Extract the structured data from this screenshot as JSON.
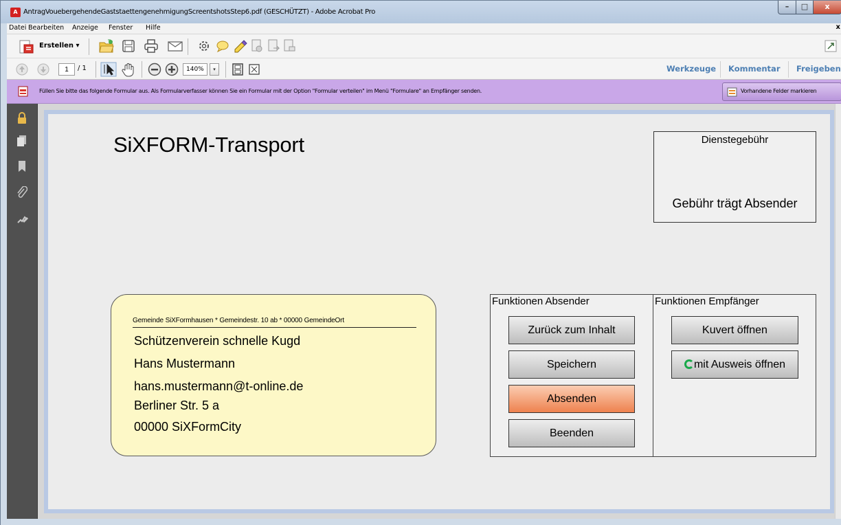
{
  "window": {
    "title": "AntragVouebergehendeGaststaettengenehmigungScreentshotsStep6.pdf (GESCHÜTZT) - Adobe Acrobat Pro",
    "controls": {
      "minimize": "–",
      "maximize": "□",
      "close": "x"
    }
  },
  "menu": {
    "items": [
      "Datei",
      "Bearbeiten",
      "Anzeige",
      "Fenster",
      "Hilfe"
    ],
    "close": "x"
  },
  "toolbar": {
    "create_label": "Erstellen",
    "create_arrow": "▾",
    "icons": [
      "open-icon",
      "save-icon",
      "print-icon",
      "email-icon",
      "settings-icon",
      "comment-icon",
      "highlight-icon",
      "doc-action-icon",
      "doc-export-icon",
      "doc-send-icon",
      "expand-icon"
    ]
  },
  "navigation": {
    "current_page": "1",
    "total_pages": "/ 1",
    "zoom": "140%",
    "zoom_arrow": "▾"
  },
  "panels": {
    "tools": "Werkzeuge",
    "comment": "Kommentar",
    "share": "Freigeben"
  },
  "formbar": {
    "message": "Füllen Sie bitte das folgende Formular aus. Als Formularverfasser können Sie ein Formular mit der Option \"Formular verteilen\" im Menü \"Formulare\" an Empfänger senden.",
    "highlight_button": "Vorhandene Felder markieren"
  },
  "form": {
    "title": "SiXFORM-Transport",
    "fee": {
      "header": "Dienstegebühr",
      "value": "Gebühr trägt Absender"
    },
    "address": {
      "sender_line": "Gemeinde SiXFormhausen * Gemeindestr. 10 ab * 00000 GemeindeOrt",
      "lines": [
        "Schützenverein schnelle Kugd",
        "Hans Mustermann",
        "hans.mustermann@t-online.de",
        "Berliner Str. 5 a",
        "00000  SiXFormCity"
      ]
    },
    "sender_functions": {
      "header": "Funktionen Absender",
      "buttons": [
        "Zurück zum Inhalt",
        "Speichern",
        "Absenden",
        "Beenden"
      ]
    },
    "receiver_functions": {
      "header": "Funktionen Empfänger",
      "buttons": [
        "Kuvert öffnen",
        "mit Ausweis öffnen"
      ]
    }
  },
  "colors": {
    "formbar_bg": "#c9a7e8",
    "panel_link": "#4d7fb3",
    "address_bg": "#fdf8c7",
    "send_button": "#ee824f",
    "page_border": "#b9c9e4"
  }
}
